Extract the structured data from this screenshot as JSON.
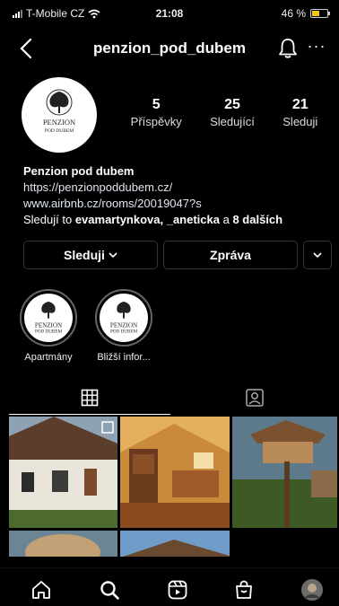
{
  "status_bar": {
    "carrier": "T-Mobile CZ",
    "time": "21:08",
    "battery": "46 %",
    "battery_level": 0.46
  },
  "header": {
    "username": "penzion_pod_dubem"
  },
  "profile": {
    "logo_lines": [
      "PENZION",
      "POD DUBEM"
    ],
    "stats": [
      {
        "value": "5",
        "label": "Příspěvky"
      },
      {
        "value": "25",
        "label": "Sledující"
      },
      {
        "value": "21",
        "label": "Sleduji"
      }
    ],
    "name": "Penzion pod dubem",
    "link1": "https://penzionpoddubem.cz/",
    "link2": "www.airbnb.cz/rooms/20019047?s",
    "followed_prefix": "Sledují to ",
    "followed_users": "evamartynkova, _aneticka",
    "followed_middle": " a ",
    "followed_more": "8 dalších"
  },
  "actions": {
    "follow_label": "Sleduji",
    "message_label": "Zpráva"
  },
  "highlights": [
    {
      "label": "Apartmány"
    },
    {
      "label": "Bližší infor..."
    }
  ],
  "colors": {
    "background": "#000000",
    "battery": "#f0c814"
  },
  "nav": {
    "icons": [
      "home-icon",
      "search-icon",
      "reels-icon",
      "shop-icon",
      "profile-avatar"
    ]
  }
}
